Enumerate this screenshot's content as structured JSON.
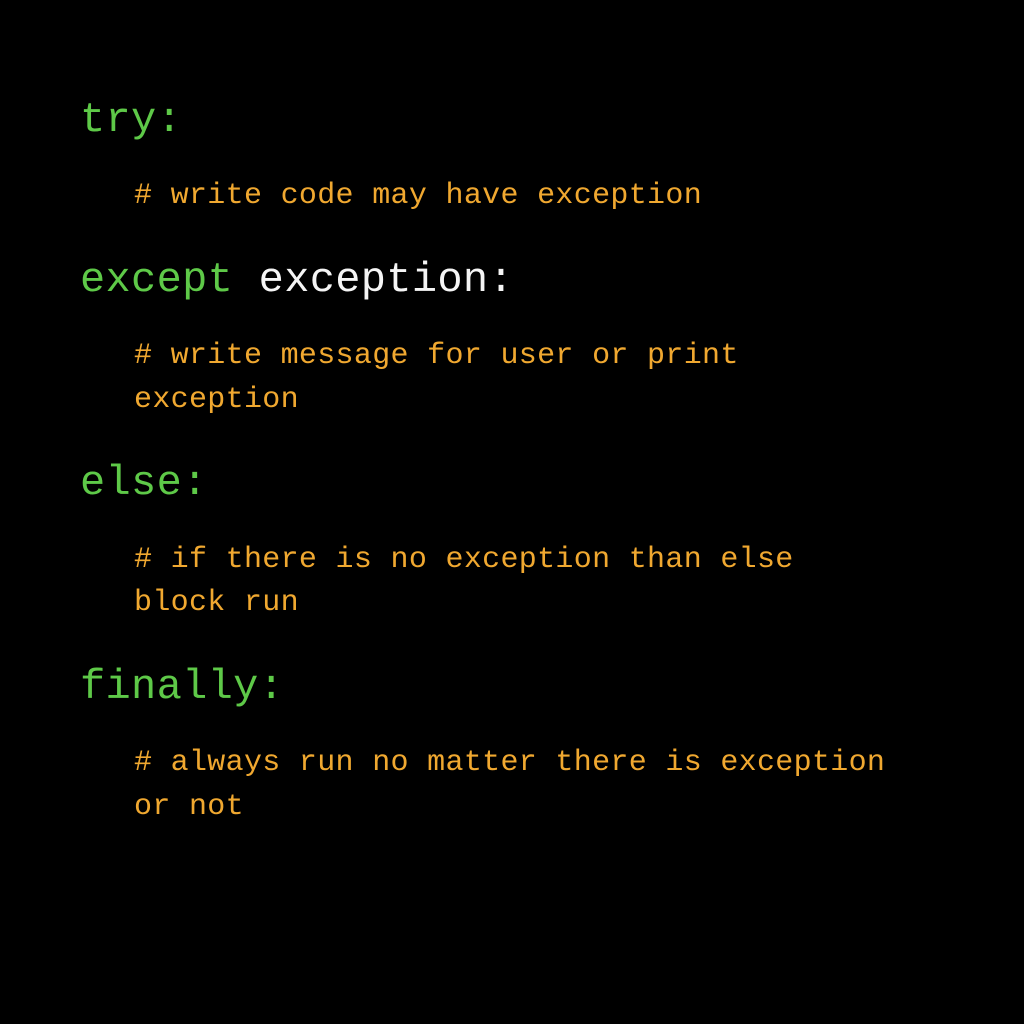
{
  "colors": {
    "keyword": "#5ec948",
    "identifier": "#f5f5f5",
    "comment": "#f0a830",
    "background": "#000000"
  },
  "sections": [
    {
      "keyword": "try",
      "identifier": "",
      "colon": ":",
      "comment": "# write code may have exception"
    },
    {
      "keyword": "except",
      "identifier": " exception",
      "colon": ":",
      "comment": "# write message for user or print exception"
    },
    {
      "keyword": "else",
      "identifier": "",
      "colon": ":",
      "comment": "# if there is no exception than else block run"
    },
    {
      "keyword": "finally",
      "identifier": "",
      "colon": ":",
      "comment": "# always run no matter there is exception or not"
    }
  ]
}
